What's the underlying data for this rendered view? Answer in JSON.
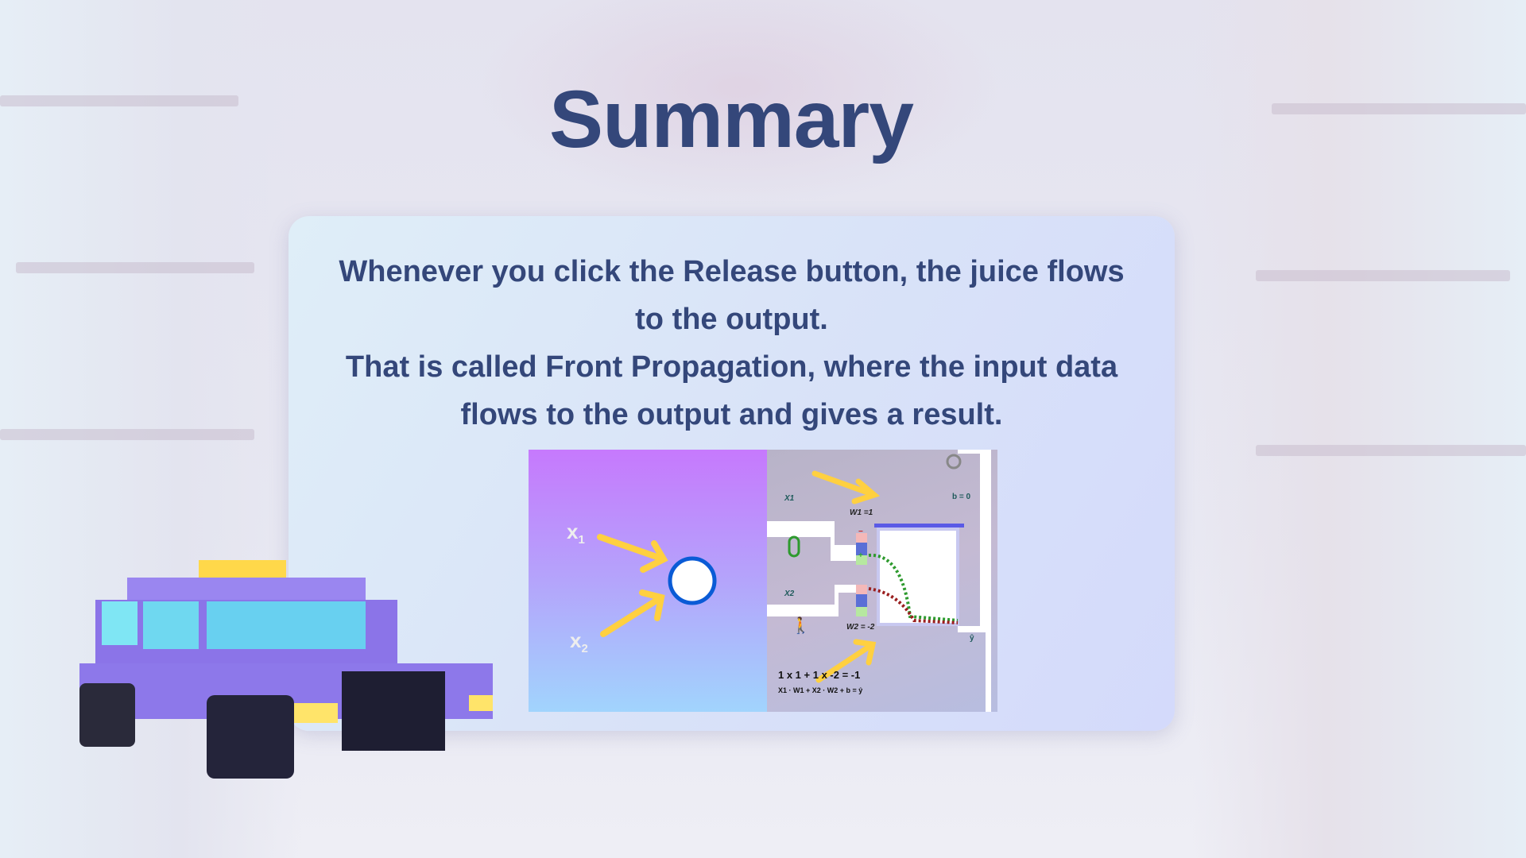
{
  "title": "Summary",
  "card": {
    "lines": [
      "Whenever you click the Release button, the juice flows",
      "to the output.",
      "That is called Front Propagation, where the input data",
      "flows to the output and gives a result."
    ]
  },
  "figure": {
    "neuron": {
      "x1": "x",
      "x1_sub": "1",
      "x2": "x",
      "x2_sub": "2"
    },
    "game": {
      "x1_label": "X1",
      "x2_label": "X2",
      "w1_label": "W1 =1",
      "w2_label": "W2 = -2",
      "bias_label": "b = 0",
      "output_label": "ŷ",
      "equation": "1 x 1 + 1 x -2 = -1",
      "formula": "X1 · W1 + X2 · W2 + b = ŷ",
      "minus": "−",
      "plus": "+"
    }
  },
  "colors": {
    "title": "#34477a",
    "arrow": "#ffd040",
    "neuron_border": "#0a5bd6"
  }
}
